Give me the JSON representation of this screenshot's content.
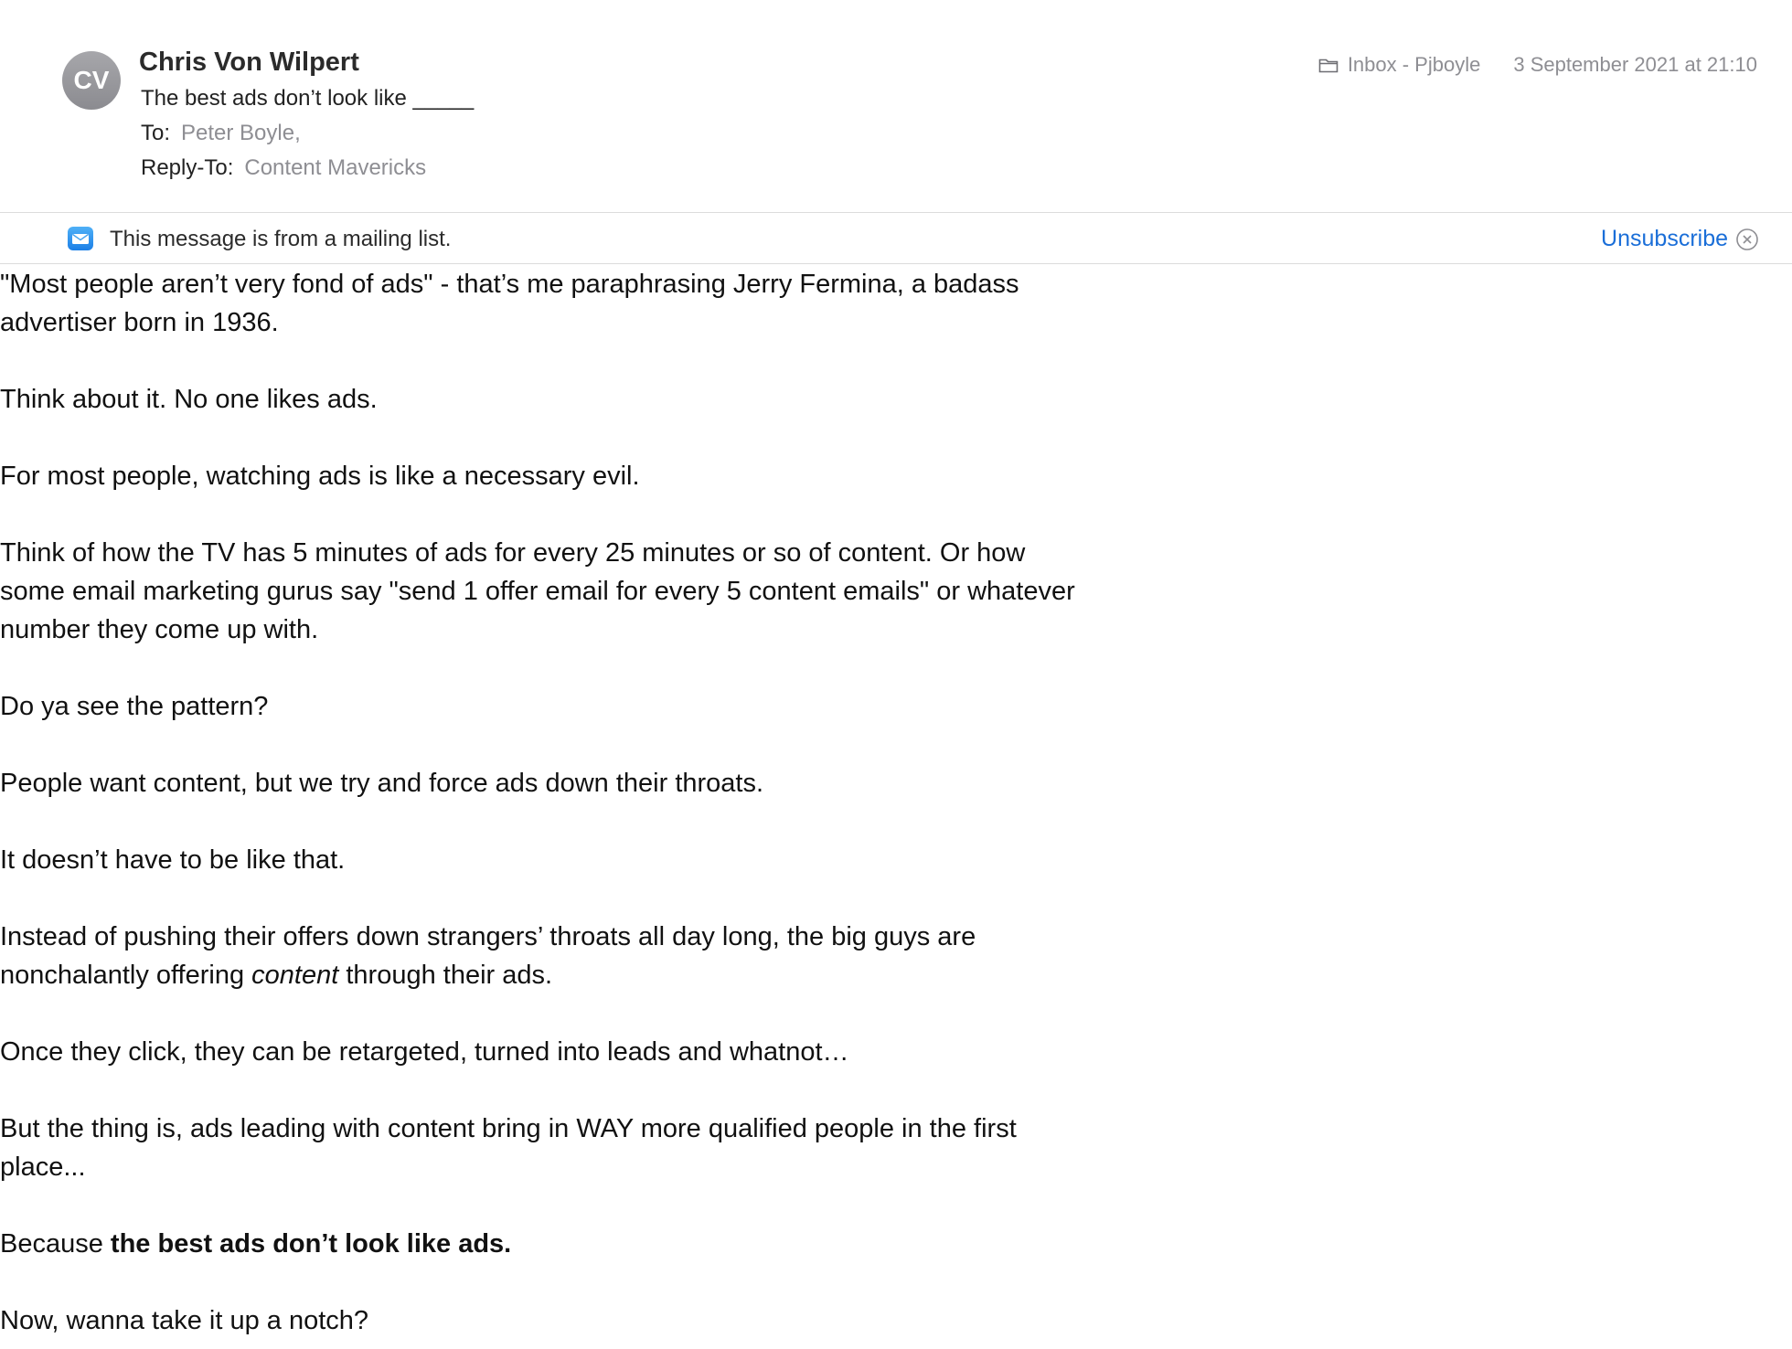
{
  "email": {
    "avatar_initials": "CV",
    "sender": "Chris Von Wilpert",
    "subject": "The best ads don’t look like _____",
    "to_label": "To:",
    "to_value": "Peter Boyle,",
    "reply_to_label": "Reply-To:",
    "reply_to_value": "Content Mavericks",
    "mailbox": "Inbox - Pjboyle",
    "date": "3 September 2021 at 21:10"
  },
  "banner": {
    "text": "This message is from a mailing list.",
    "unsubscribe_label": "Unsubscribe"
  },
  "body": {
    "p1": "\"Most people aren’t very fond of ads\" - that’s me paraphrasing Jerry Fermina, a badass advertiser born in 1936.",
    "p2": "Think about it. No one likes ads.",
    "p3": "For most people, watching ads is like a necessary evil.",
    "p4": "Think of how the TV has 5 minutes of ads for every 25 minutes or so of content. Or how some email marketing gurus say \"send 1 offer email for every 5 content emails\" or whatever number they come up with.",
    "p5": "Do ya see the pattern?",
    "p6": "People want content, but we try and force ads down their throats.",
    "p7": "It doesn’t have to be like that.",
    "p8_pre": "Instead of pushing their offers down strangers’ throats all day long, the big guys are nonchalantly offering ",
    "p8_em": "content",
    "p8_post": " through their ads.",
    "p9": "Once they click, they can be retargeted, turned into leads and whatnot…",
    "p10": "But the thing is, ads leading with content bring in WAY more qualified people in the first place...",
    "p11_pre": "Because ",
    "p11_bold": "the best ads don’t look like ads.",
    "p12": "Now, wanna take it up a notch?"
  },
  "colors": {
    "link": "#1a6ed8",
    "muted": "#8e8e93",
    "avatar": "#9a9a9f"
  },
  "icons": [
    "folder-icon",
    "mail-icon",
    "close-circle-icon"
  ]
}
